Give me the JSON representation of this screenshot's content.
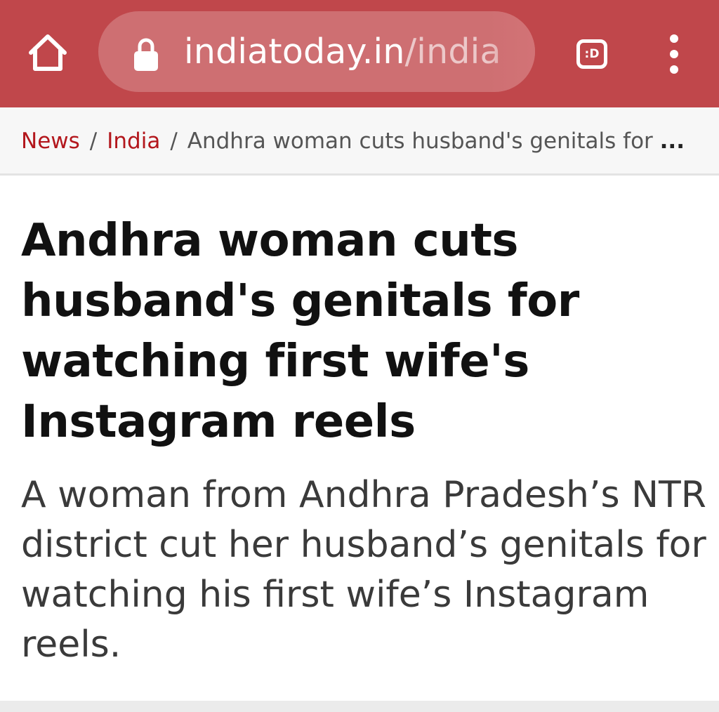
{
  "browser": {
    "url_host": "indiatoday.in",
    "url_path": "/india",
    "tab_switcher_label": ":D",
    "icons": {
      "home": "home-icon",
      "lock": "lock-icon",
      "tab_switcher": "tab-switcher-icon",
      "menu": "overflow-menu-icon"
    },
    "colors": {
      "toolbar": "#c0474b",
      "breadcrumb_link": "#b3171d"
    }
  },
  "breadcrumb": {
    "items": [
      {
        "label": "News"
      },
      {
        "label": "India"
      }
    ],
    "separator": "/",
    "current": "Andhra woman cuts husband's genitals for",
    "ellipsis": "..."
  },
  "article": {
    "headline": "Andhra woman cuts husband's genitals for watching first wife's Instagram reels",
    "summary": "A woman from Andhra Pradesh’s NTR district cut her husband’s genitals for watching his first wife’s Instagram reels."
  }
}
